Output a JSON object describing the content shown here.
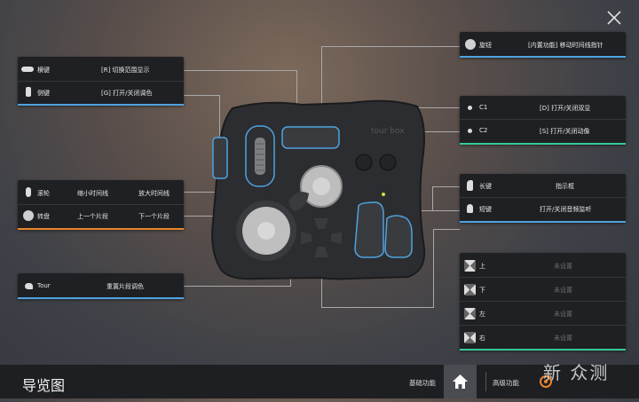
{
  "header": {
    "close_label": "×"
  },
  "left_panel_1": {
    "rows": [
      {
        "icon": "horizontal-key-icon",
        "name": "横键",
        "function": "[R] 切换范围显示"
      },
      {
        "icon": "side-key-icon",
        "name": "侧键",
        "function": "[G] 打开/关闭调色"
      }
    ]
  },
  "left_panel_2": {
    "rows": [
      {
        "icon": "scroll-wheel-icon",
        "name": "滚轮",
        "left_action": "缩小时间线",
        "right_action": "放大时间线"
      },
      {
        "icon": "dial-icon",
        "name": "转盘",
        "left_action": "上一个片段",
        "right_action": "下一个片段"
      }
    ]
  },
  "left_panel_3": {
    "rows": [
      {
        "icon": "tour-icon",
        "name": "Tour",
        "function": "重置片段调色"
      }
    ]
  },
  "right_panel_1": {
    "rows": [
      {
        "icon": "knob-icon",
        "name": "旋钮",
        "function": "[内置功能] 移动时间线指针"
      }
    ]
  },
  "right_panel_2": {
    "rows": [
      {
        "icon": "dot-icon",
        "name": "C1",
        "function": "[D] 打开/关闭双显"
      },
      {
        "icon": "dot-icon",
        "name": "C2",
        "function": "[S] 打开/关闭动像"
      }
    ]
  },
  "right_panel_3": {
    "rows": [
      {
        "icon": "long-key-icon",
        "name": "长键",
        "function": "指示框"
      },
      {
        "icon": "short-key-icon",
        "name": "短键",
        "function": "打开/关闭音频监听"
      }
    ]
  },
  "right_panel_4": {
    "rows": [
      {
        "icon": "dpad-up-icon",
        "name": "上",
        "function": "未设置"
      },
      {
        "icon": "dpad-down-icon",
        "name": "下",
        "function": "未设置"
      },
      {
        "icon": "dpad-left-icon",
        "name": "左",
        "function": "未设置"
      },
      {
        "icon": "dpad-right-icon",
        "name": "右",
        "function": "未设置"
      }
    ]
  },
  "device": {
    "brand": "tour box"
  },
  "footer": {
    "title": "导览图",
    "tab_basic": "基础功能",
    "tab_advanced": "高级功能",
    "watermark": "新 众测"
  },
  "colors": {
    "blue": "#4da3e0",
    "orange": "#e8852c",
    "green": "#37c99a",
    "panel": "#1f2023"
  }
}
